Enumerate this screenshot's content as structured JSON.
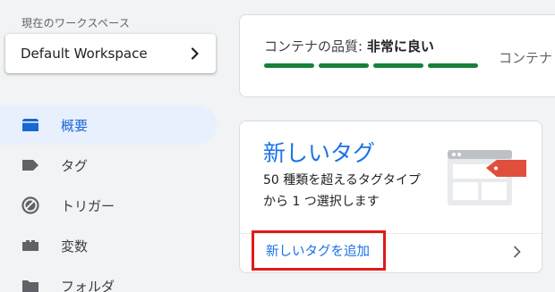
{
  "sidebar": {
    "workspace_caption": "現在のワークスペース",
    "workspace_name": "Default Workspace",
    "items": [
      {
        "label": "概要",
        "icon": "overview-icon",
        "active": true
      },
      {
        "label": "タグ",
        "icon": "tag-icon",
        "active": false
      },
      {
        "label": "トリガー",
        "icon": "trigger-icon",
        "active": false
      },
      {
        "label": "変数",
        "icon": "variables-icon",
        "active": false
      },
      {
        "label": "フォルダ",
        "icon": "folder-icon",
        "active": false
      }
    ]
  },
  "quality": {
    "label": "コンテナの品質: ",
    "value": "非常に良い",
    "segments": 4,
    "color": "#188038",
    "secondary_label": "コンテナ"
  },
  "new_tag_card": {
    "title": "新しいタグ",
    "description": "50 種類を超えるタグタイプから 1 つ選択します",
    "add_link": "新しいタグを追加"
  },
  "colors": {
    "accent": "#1a73e8",
    "active_bg": "#e8f0fe",
    "highlight": "#e01a1a",
    "tag_red": "#e04f3c"
  }
}
